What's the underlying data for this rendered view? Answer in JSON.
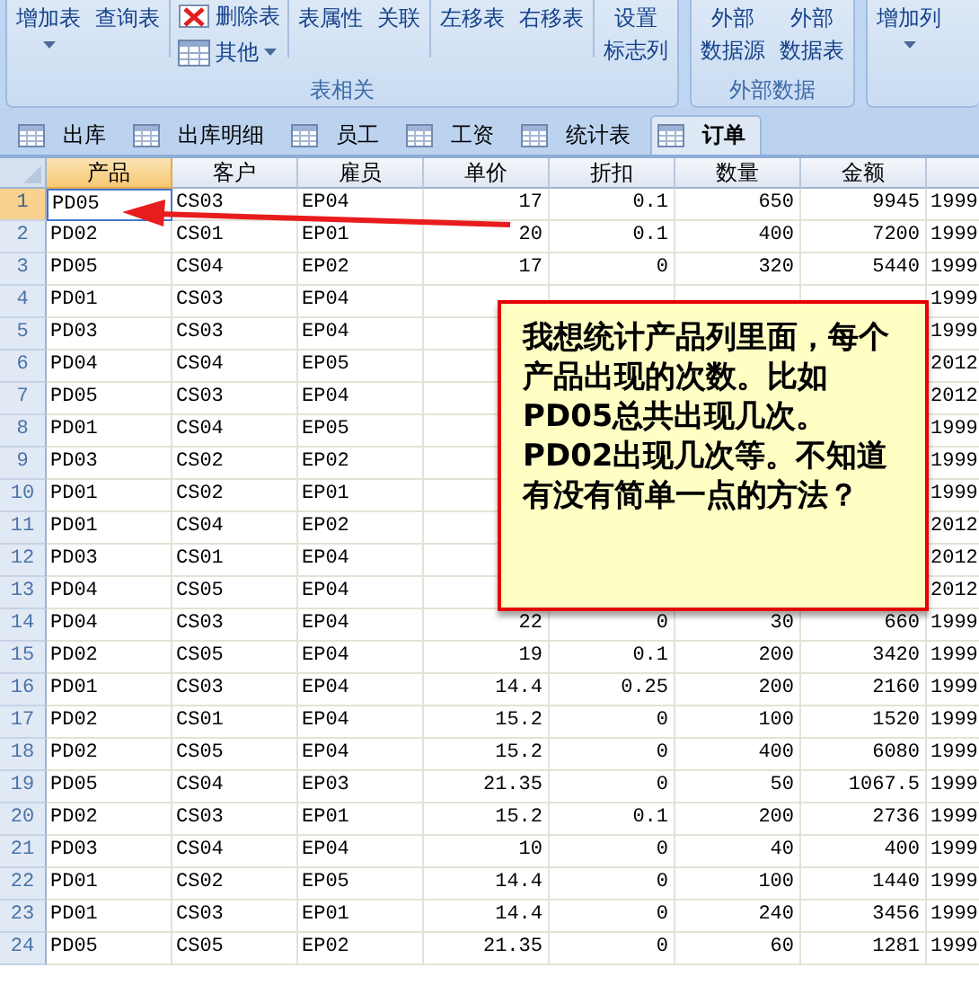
{
  "ribbon": {
    "groups": [
      {
        "label": "表相关",
        "sections": [
          {
            "kind": "large",
            "commands": [
              {
                "lines": [
                  "增加表"
                ],
                "dropdown": true
              },
              {
                "lines": [
                  "查询表"
                ],
                "dropdown": false
              }
            ]
          },
          {
            "kind": "small",
            "commands": [
              {
                "lines": [
                  "删除表"
                ],
                "dropdown": false
              },
              {
                "lines": [
                  "其他"
                ],
                "dropdown": true
              }
            ]
          },
          {
            "kind": "large",
            "commands": [
              {
                "lines": [
                  "表属性"
                ],
                "dropdown": false
              },
              {
                "lines": [
                  "关联"
                ],
                "dropdown": false
              }
            ]
          },
          {
            "kind": "large",
            "commands": [
              {
                "lines": [
                  "左移表"
                ],
                "dropdown": false
              },
              {
                "lines": [
                  "右移表"
                ],
                "dropdown": false
              }
            ]
          },
          {
            "kind": "large",
            "commands": [
              {
                "lines": [
                  "设置",
                  "标志列"
                ],
                "dropdown": false
              }
            ]
          }
        ]
      },
      {
        "label": "外部数据",
        "sections": [
          {
            "kind": "large",
            "commands": [
              {
                "lines": [
                  "外部",
                  "数据源"
                ],
                "dropdown": false
              },
              {
                "lines": [
                  "外部",
                  "数据表"
                ],
                "dropdown": false
              }
            ]
          }
        ]
      },
      {
        "sections": [
          {
            "kind": "large",
            "commands": [
              {
                "lines": [
                  "增加列"
                ],
                "dropdown": true
              }
            ]
          }
        ]
      }
    ]
  },
  "tabs": [
    {
      "label": "出库",
      "selected": false
    },
    {
      "label": "出库明细",
      "selected": false
    },
    {
      "label": "员工",
      "selected": false
    },
    {
      "label": "工资",
      "selected": false
    },
    {
      "label": "统计表",
      "selected": false
    },
    {
      "label": "订单",
      "selected": true
    }
  ],
  "table": {
    "columns": [
      {
        "label": "产品",
        "kind": "text",
        "selected": true
      },
      {
        "label": "客户",
        "kind": "text",
        "selected": false
      },
      {
        "label": "雇员",
        "kind": "text",
        "selected": false
      },
      {
        "label": "单价",
        "kind": "number",
        "selected": false
      },
      {
        "label": "折扣",
        "kind": "number",
        "selected": false
      },
      {
        "label": "数量",
        "kind": "number",
        "selected": false
      },
      {
        "label": "金额",
        "kind": "number",
        "selected": false
      },
      {
        "kind": "text",
        "selected": false
      }
    ],
    "rows": [
      {
        "number": "1",
        "selected": true,
        "cells": [
          "PD05",
          "CS03",
          "EP04",
          "17",
          "0.1",
          "650",
          "9945",
          "1999"
        ]
      },
      {
        "number": "2",
        "selected": false,
        "cells": [
          "PD02",
          "CS01",
          "EP01",
          "20",
          "0.1",
          "400",
          "7200",
          "1999"
        ]
      },
      {
        "number": "3",
        "selected": false,
        "cells": [
          "PD05",
          "CS04",
          "EP02",
          "17",
          "0",
          "320",
          "5440",
          "1999"
        ]
      },
      {
        "number": "4",
        "selected": false,
        "cells": [
          "PD01",
          "CS03",
          "EP04",
          null,
          null,
          null,
          null,
          "1999"
        ]
      },
      {
        "number": "5",
        "selected": false,
        "cells": [
          "PD03",
          "CS03",
          "EP04",
          null,
          null,
          null,
          null,
          "1999"
        ]
      },
      {
        "number": "6",
        "selected": false,
        "cells": [
          "PD04",
          "CS04",
          "EP05",
          null,
          null,
          null,
          null,
          "2012"
        ]
      },
      {
        "number": "7",
        "selected": false,
        "cells": [
          "PD05",
          "CS03",
          "EP04",
          null,
          null,
          null,
          null,
          "2012"
        ]
      },
      {
        "number": "8",
        "selected": false,
        "cells": [
          "PD01",
          "CS04",
          "EP05",
          null,
          null,
          null,
          null,
          "1999"
        ]
      },
      {
        "number": "9",
        "selected": false,
        "cells": [
          "PD03",
          "CS02",
          "EP02",
          null,
          null,
          null,
          null,
          "1999"
        ]
      },
      {
        "number": "10",
        "selected": false,
        "cells": [
          "PD01",
          "CS02",
          "EP01",
          null,
          null,
          null,
          null,
          "1999"
        ]
      },
      {
        "number": "11",
        "selected": false,
        "cells": [
          "PD01",
          "CS04",
          "EP02",
          null,
          null,
          null,
          null,
          "2012"
        ]
      },
      {
        "number": "12",
        "selected": false,
        "cells": [
          "PD03",
          "CS01",
          "EP04",
          null,
          null,
          null,
          null,
          "2012"
        ]
      },
      {
        "number": "13",
        "selected": false,
        "cells": [
          "PD04",
          "CS05",
          "EP04",
          null,
          null,
          null,
          null,
          "2012"
        ]
      },
      {
        "number": "14",
        "selected": false,
        "cells": [
          "PD04",
          "CS03",
          "EP04",
          "22",
          "0",
          "30",
          "660",
          "1999"
        ]
      },
      {
        "number": "15",
        "selected": false,
        "cells": [
          "PD02",
          "CS05",
          "EP04",
          "19",
          "0.1",
          "200",
          "3420",
          "1999"
        ]
      },
      {
        "number": "16",
        "selected": false,
        "cells": [
          "PD01",
          "CS03",
          "EP04",
          "14.4",
          "0.25",
          "200",
          "2160",
          "1999"
        ]
      },
      {
        "number": "17",
        "selected": false,
        "cells": [
          "PD02",
          "CS01",
          "EP04",
          "15.2",
          "0",
          "100",
          "1520",
          "1999"
        ]
      },
      {
        "number": "18",
        "selected": false,
        "cells": [
          "PD02",
          "CS05",
          "EP04",
          "15.2",
          "0",
          "400",
          "6080",
          "1999"
        ]
      },
      {
        "number": "19",
        "selected": false,
        "cells": [
          "PD05",
          "CS04",
          "EP03",
          "21.35",
          "0",
          "50",
          "1067.5",
          "1999"
        ]
      },
      {
        "number": "20",
        "selected": false,
        "cells": [
          "PD02",
          "CS03",
          "EP01",
          "15.2",
          "0.1",
          "200",
          "2736",
          "1999"
        ]
      },
      {
        "number": "21",
        "selected": false,
        "cells": [
          "PD03",
          "CS04",
          "EP04",
          "10",
          "0",
          "40",
          "400",
          "1999"
        ]
      },
      {
        "number": "22",
        "selected": false,
        "cells": [
          "PD01",
          "CS02",
          "EP05",
          "14.4",
          "0",
          "100",
          "1440",
          "1999"
        ]
      },
      {
        "number": "23",
        "selected": false,
        "cells": [
          "PD01",
          "CS03",
          "EP01",
          "14.4",
          "0",
          "240",
          "3456",
          "1999"
        ]
      },
      {
        "number": "24",
        "selected": false,
        "cells": [
          "PD05",
          "CS05",
          "EP02",
          "21.35",
          "0",
          "60",
          "1281",
          "1999"
        ]
      }
    ]
  },
  "callout": {
    "text": "我想统计产品列里面，每个产品出现的次数。比如PD05总共出现几次。PD02出现几次等。不知道有没有简单一点的方法？"
  }
}
